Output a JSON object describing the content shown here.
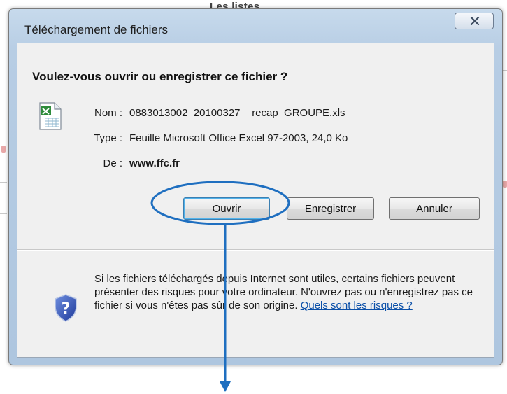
{
  "background": {
    "heading": "Les listes"
  },
  "dialog": {
    "title": "Téléchargement de fichiers",
    "question": "Voulez-vous ouvrir ou enregistrer ce fichier ?",
    "file": {
      "name_label": "Nom :",
      "name_value": "0883013002_20100327__recap_GROUPE.xls",
      "type_label": "Type :",
      "type_value": "Feuille Microsoft Office Excel 97-2003, 24,0 Ko",
      "from_label": "De :",
      "from_value": "www.ffc.fr"
    },
    "buttons": {
      "open": "Ouvrir",
      "save": "Enregistrer",
      "cancel": "Annuler"
    },
    "warning": {
      "text": "Si les fichiers téléchargés depuis Internet sont utiles, certains fichiers peuvent présenter des risques pour votre ordinateur. N'ouvrez pas ou n'enregistrez pas ce fichier si vous n'êtes pas sûr de son origine.",
      "link": "Quels sont les risques ?"
    }
  },
  "colors": {
    "annotation": "#1f6fc0",
    "link": "#0a4fa8",
    "excel_green": "#2e8b3a"
  },
  "icons": {
    "file": "excel-file-icon",
    "warning": "shield-question-icon",
    "close": "close-icon"
  }
}
